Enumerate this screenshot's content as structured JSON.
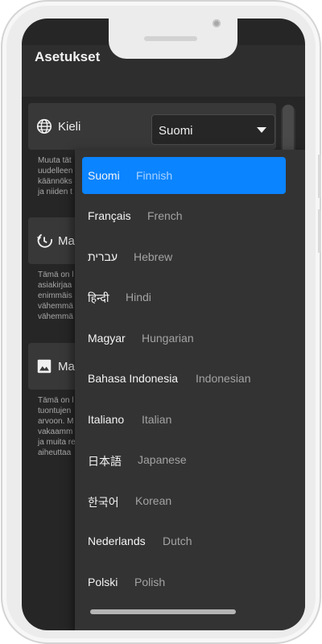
{
  "header": {
    "title": "Asetukset"
  },
  "language": {
    "label": "Kieli",
    "selected_value": "Suomi",
    "description": "Muuta tät\nuudelleen\nkäännöks\nja niiden t",
    "options": [
      {
        "native": "Suomi",
        "english": "Finnish",
        "selected": true
      },
      {
        "native": "Français",
        "english": "French"
      },
      {
        "native": "עברית",
        "english": "Hebrew"
      },
      {
        "native": "हिन्दी",
        "english": "Hindi"
      },
      {
        "native": "Magyar",
        "english": "Hungarian"
      },
      {
        "native": "Bahasa Indonesia",
        "english": "Indonesian"
      },
      {
        "native": "Italiano",
        "english": "Italian"
      },
      {
        "native": "日本語",
        "english": "Japanese"
      },
      {
        "native": "한국어",
        "english": "Korean"
      },
      {
        "native": "Nederlands",
        "english": "Dutch"
      },
      {
        "native": "Polski",
        "english": "Polish"
      }
    ]
  },
  "history": {
    "label": "Ma",
    "description": "Tämä on l\nasiakirjaa\nenimmäis\nvähemmä\nvähemmä"
  },
  "media": {
    "label": "Ma",
    "description": "Tämä on l\ntuontujen\narvoon. M\nvakaamm\nja muita re\naiheuttaa"
  },
  "icons": {
    "language": "globe-icon",
    "history": "history-icon",
    "media": "image-icon",
    "dropdown": "chevron-down-icon"
  },
  "colors": {
    "accent": "#0a84ff",
    "background": "#262626",
    "card": "#383838",
    "menu": "#333333"
  }
}
